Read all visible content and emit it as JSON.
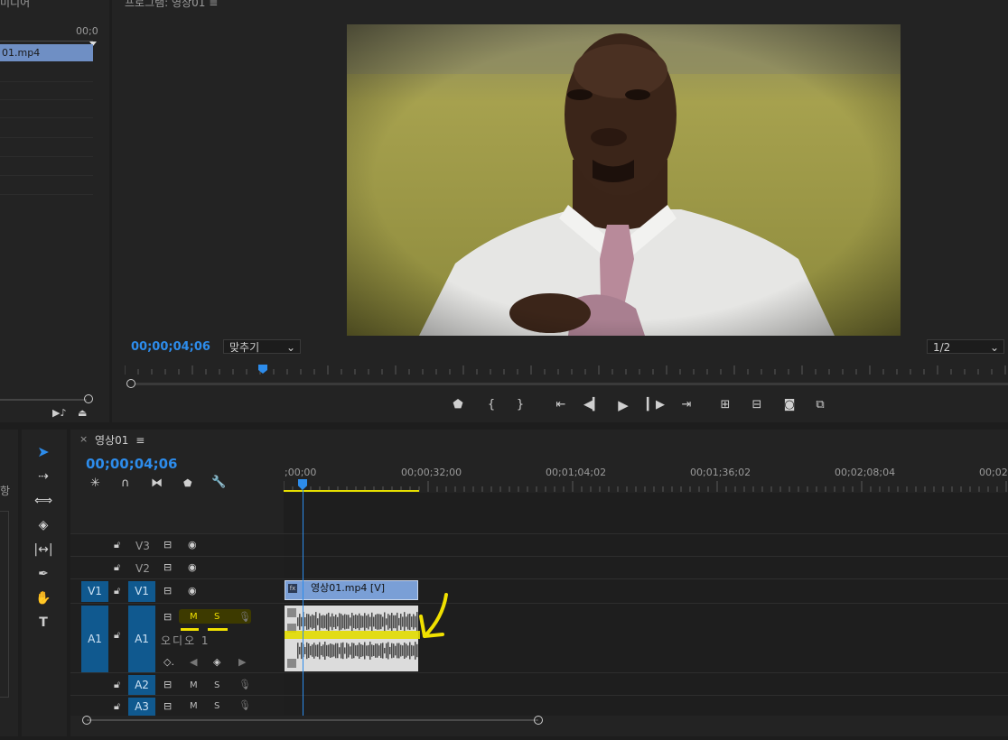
{
  "project_panel": {
    "title": "미디어",
    "timecode": "00;0",
    "clip_name": "01.mp4"
  },
  "program_monitor": {
    "title": "프로그램: 영상01",
    "menu_icon": "≡",
    "timecode": "00;00;04;06",
    "fit_label": "맞추기",
    "quality_label": "1/2",
    "controls": [
      "add-marker",
      "mark-in",
      "mark-out",
      "go-to-in",
      "step-back",
      "play",
      "step-forward",
      "go-to-out",
      "lift",
      "extract",
      "export-frame",
      "comparison-view"
    ]
  },
  "timeline": {
    "close_icon": "×",
    "sequence_name": "영상01",
    "menu_icon": "≡",
    "timecode": "00;00;04;06",
    "ruler": [
      ";00;00",
      "00;00;32;00",
      "00;01;04;02",
      "00;01;36;02",
      "00;02;08;04",
      "00;02"
    ],
    "tracks": {
      "v3": "V3",
      "v2": "V2",
      "v1": "V1",
      "v1_source": "V1",
      "a1": "A1",
      "a1_source": "A1",
      "a1_name": "오디오 1",
      "a2": "A2",
      "a3": "A3"
    },
    "mute_label": "M",
    "solo_label": "S",
    "video_clip": "영상01.mp4 [V]",
    "fx_badge": "fx"
  },
  "side_panel": {
    "label": "항"
  },
  "colors": {
    "accent_blue": "#2d8ceb",
    "clip_video": "#7a9fd6",
    "clip_audio": "#dcdcdc",
    "annotation": "#f0e000"
  }
}
